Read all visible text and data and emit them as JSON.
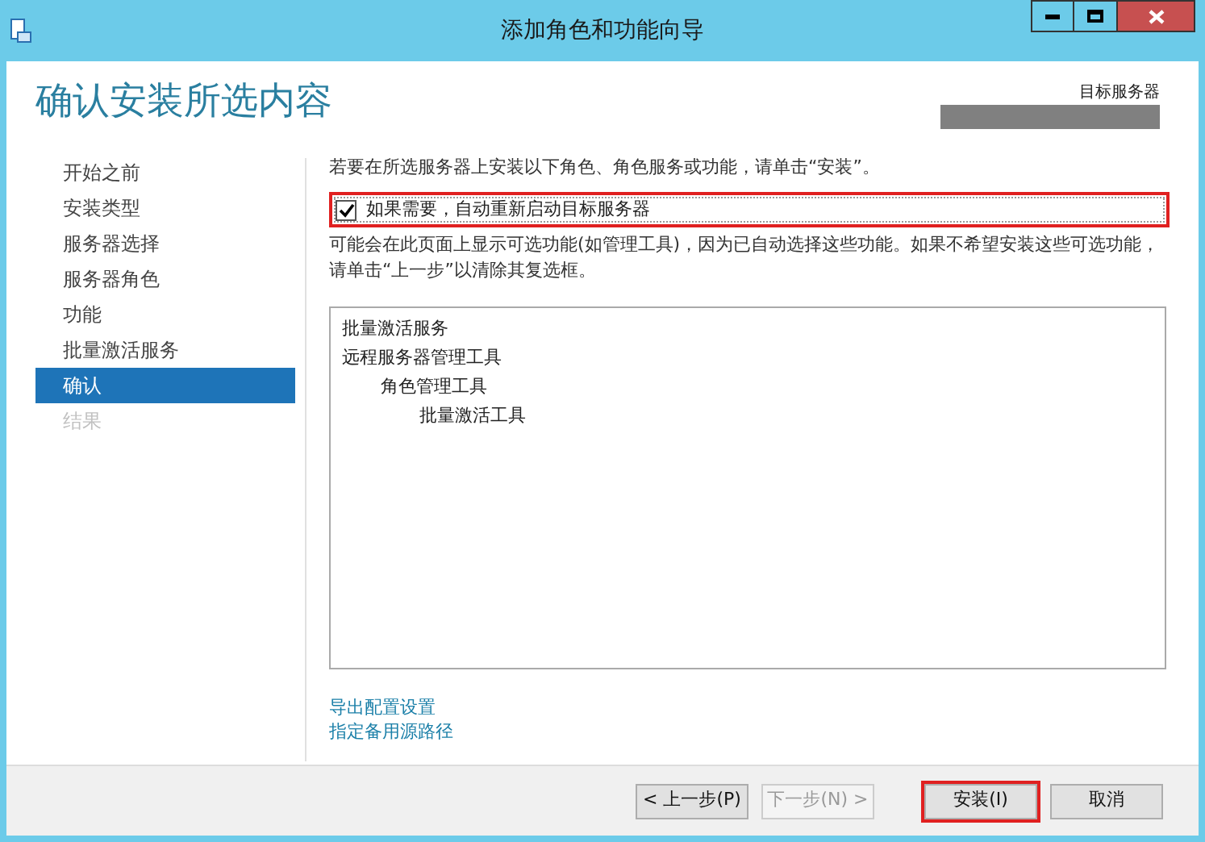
{
  "window": {
    "title": "添加角色和功能向导"
  },
  "header": {
    "title": "确认安装所选内容",
    "target_label": "目标服务器"
  },
  "sidebar": {
    "items": [
      {
        "label": "开始之前",
        "selected": false,
        "disabled": false
      },
      {
        "label": "安装类型",
        "selected": false,
        "disabled": false
      },
      {
        "label": "服务器选择",
        "selected": false,
        "disabled": false
      },
      {
        "label": "服务器角色",
        "selected": false,
        "disabled": false
      },
      {
        "label": "功能",
        "selected": false,
        "disabled": false
      },
      {
        "label": "批量激活服务",
        "selected": false,
        "disabled": false
      },
      {
        "label": "确认",
        "selected": true,
        "disabled": false
      },
      {
        "label": "结果",
        "selected": false,
        "disabled": true
      }
    ]
  },
  "intro": "若要在所选服务器上安装以下角色、角色服务或功能，请单击“安装”。",
  "restart_option": {
    "label": "如果需要，自动重新启动目标服务器",
    "checked": true
  },
  "note": "可能会在此页面上显示可选功能(如管理工具)，因为已自动选择这些功能。如果不希望安装这些可选功能，请单击“上一步”以清除其复选框。",
  "features": [
    {
      "label": "批量激活服务"
    },
    {
      "label": "远程服务器管理工具",
      "children": [
        {
          "label": "角色管理工具",
          "children": [
            {
              "label": "批量激活工具"
            }
          ]
        }
      ]
    }
  ],
  "links": [
    "导出配置设置",
    "指定备用源路径"
  ],
  "buttons": [
    {
      "label": "< 上一步(P)",
      "disabled": false
    },
    {
      "label": "下一步(N) >",
      "disabled": true
    },
    {
      "label": "安装(I)",
      "disabled": false
    },
    {
      "label": "取消",
      "disabled": false
    }
  ]
}
